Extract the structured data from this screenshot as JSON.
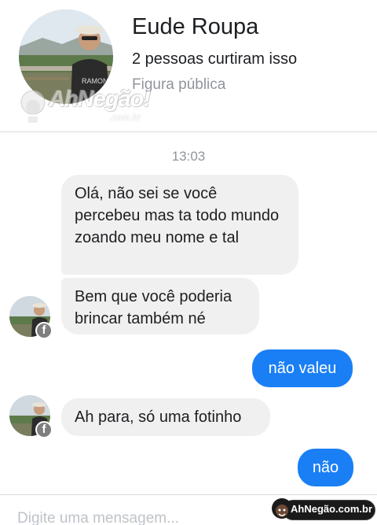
{
  "header": {
    "name": "Eude Roupa",
    "likes": "2 pessoas curtiram isso",
    "category": "Figura pública",
    "watermark_text": "AhNegão!",
    "watermark_domain": ".com.br"
  },
  "conversation": {
    "timestamp": "13:03",
    "messages": [
      {
        "from": "page",
        "text": "Olá, não sei se você percebeu mas ta todo mundo zoando meu nome e tal"
      },
      {
        "from": "page",
        "text": "Bem que você poderia brincar também né"
      },
      {
        "from": "me",
        "text": "não valeu"
      },
      {
        "from": "page",
        "text": "Ah para, só uma fotinho"
      },
      {
        "from": "me",
        "text": "não"
      }
    ]
  },
  "composer": {
    "placeholder": "Digite uma mensagem..."
  },
  "badge": {
    "text": "AhNegão.com.br"
  },
  "colors": {
    "outgoing_bubble": "#1a7ff5",
    "incoming_bubble": "#f1f0f0",
    "muted_text": "#90949c"
  },
  "icons": {
    "facebook_badge": "facebook-icon"
  }
}
